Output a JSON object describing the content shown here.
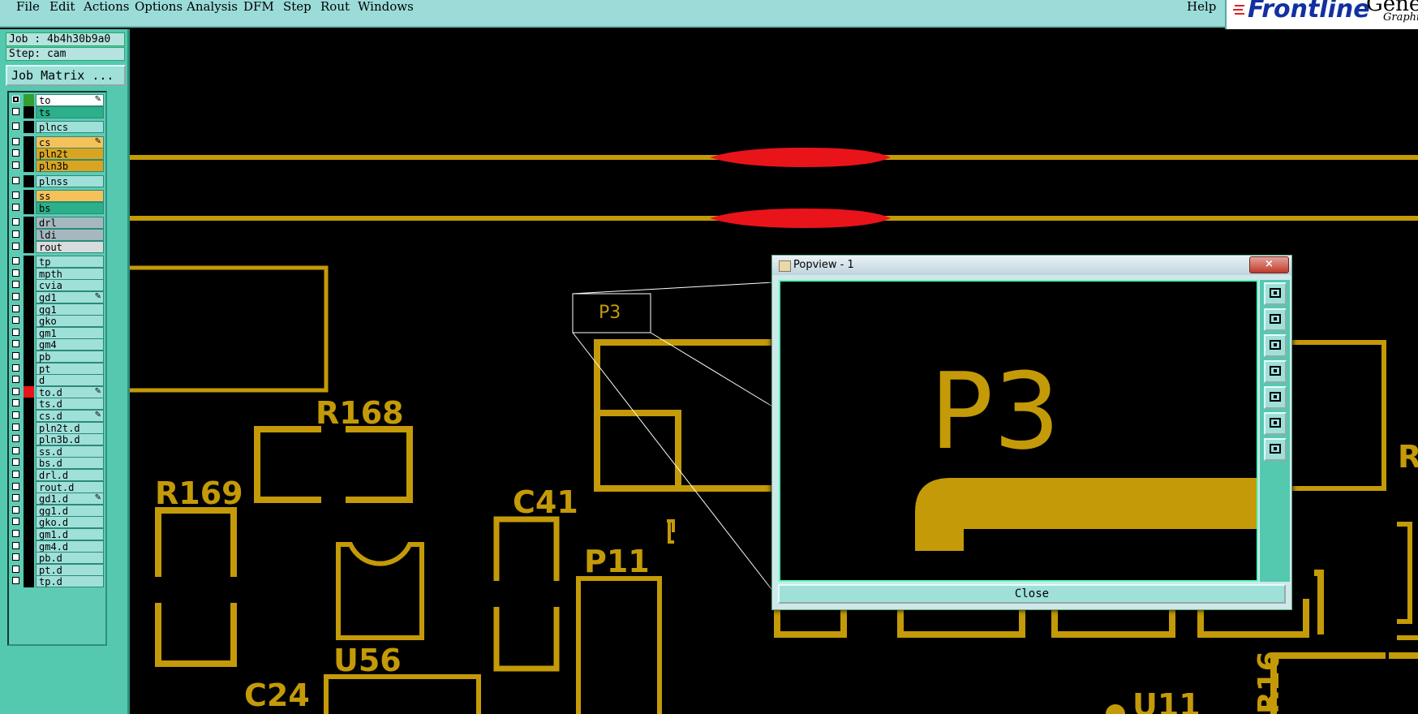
{
  "menu": {
    "file": "File",
    "edit": "Edit",
    "actions": "Actions",
    "options": "Options",
    "analysis": "Analysis",
    "dfm": "DFM",
    "step": "Step",
    "rout": "Rout",
    "windows": "Windows",
    "help": "Help"
  },
  "logo": {
    "brand": "Frontline",
    "product": "Genesis",
    "sub": "Graphic"
  },
  "panel": {
    "job": "Job : 4b4h30b9a0",
    "step": "Step: cam",
    "job_matrix": "Job Matrix ..."
  },
  "layers": [
    {
      "name": "to",
      "color": "#ffffff",
      "edit": true,
      "active": true
    },
    {
      "name": "ts",
      "color": "#2bb08a"
    },
    {
      "name": "plncs",
      "color": "#9fe0d9"
    },
    {
      "name": "cs",
      "color": "#f5c25a",
      "edit": true
    },
    {
      "name": "pln2t",
      "color": "#d9a520"
    },
    {
      "name": "pln3b",
      "color": "#d9a520"
    },
    {
      "name": "plnss",
      "color": "#9fe0d9"
    },
    {
      "name": "ss",
      "color": "#f5c25a"
    },
    {
      "name": "bs",
      "color": "#2bb08a"
    },
    {
      "name": "drl",
      "color": "#a6b8bf"
    },
    {
      "name": "ldi",
      "color": "#a6b8bf"
    },
    {
      "name": "rout",
      "color": "#d8dcdc"
    },
    {
      "name": "tp",
      "color": "#9fe0d9"
    },
    {
      "name": "mpth",
      "color": "#9fe0d9"
    },
    {
      "name": "cvia",
      "color": "#9fe0d9"
    },
    {
      "name": "gd1",
      "color": "#9fe0d9",
      "edit": true
    },
    {
      "name": "gg1",
      "color": "#9fe0d9"
    },
    {
      "name": "gko",
      "color": "#9fe0d9"
    },
    {
      "name": "gm1",
      "color": "#9fe0d9"
    },
    {
      "name": "gm4",
      "color": "#9fe0d9"
    },
    {
      "name": "pb",
      "color": "#9fe0d9"
    },
    {
      "name": "pt",
      "color": "#9fe0d9"
    },
    {
      "name": "d",
      "color": "#9fe0d9"
    },
    {
      "name": "to.d",
      "color": "#9fe0d9",
      "edit": true,
      "marker": "#e8141a"
    },
    {
      "name": "ts.d",
      "color": "#9fe0d9"
    },
    {
      "name": "cs.d",
      "color": "#9fe0d9",
      "edit": true
    },
    {
      "name": "pln2t.d",
      "color": "#9fe0d9"
    },
    {
      "name": "pln3b.d",
      "color": "#9fe0d9"
    },
    {
      "name": "ss.d",
      "color": "#9fe0d9"
    },
    {
      "name": "bs.d",
      "color": "#9fe0d9"
    },
    {
      "name": "drl.d",
      "color": "#9fe0d9"
    },
    {
      "name": "rout.d",
      "color": "#9fe0d9"
    },
    {
      "name": "gd1.d",
      "color": "#9fe0d9",
      "edit": true
    },
    {
      "name": "gg1.d",
      "color": "#9fe0d9"
    },
    {
      "name": "gko.d",
      "color": "#9fe0d9"
    },
    {
      "name": "gm1.d",
      "color": "#9fe0d9"
    },
    {
      "name": "gm4.d",
      "color": "#9fe0d9"
    },
    {
      "name": "pb.d",
      "color": "#9fe0d9"
    },
    {
      "name": "pt.d",
      "color": "#9fe0d9"
    },
    {
      "name": "tp.d",
      "color": "#9fe0d9"
    }
  ],
  "board": {
    "refdes": [
      "R168",
      "R169",
      "C41",
      "P11",
      "U56",
      "C24",
      "P3",
      "U11",
      "R16",
      "R"
    ],
    "copper_color": "#c49a08",
    "highlight_color": "#e8141a"
  },
  "popview": {
    "title": "Popview - 1",
    "close_x": "×",
    "zoom_label": "P3",
    "close_button": "Close"
  }
}
